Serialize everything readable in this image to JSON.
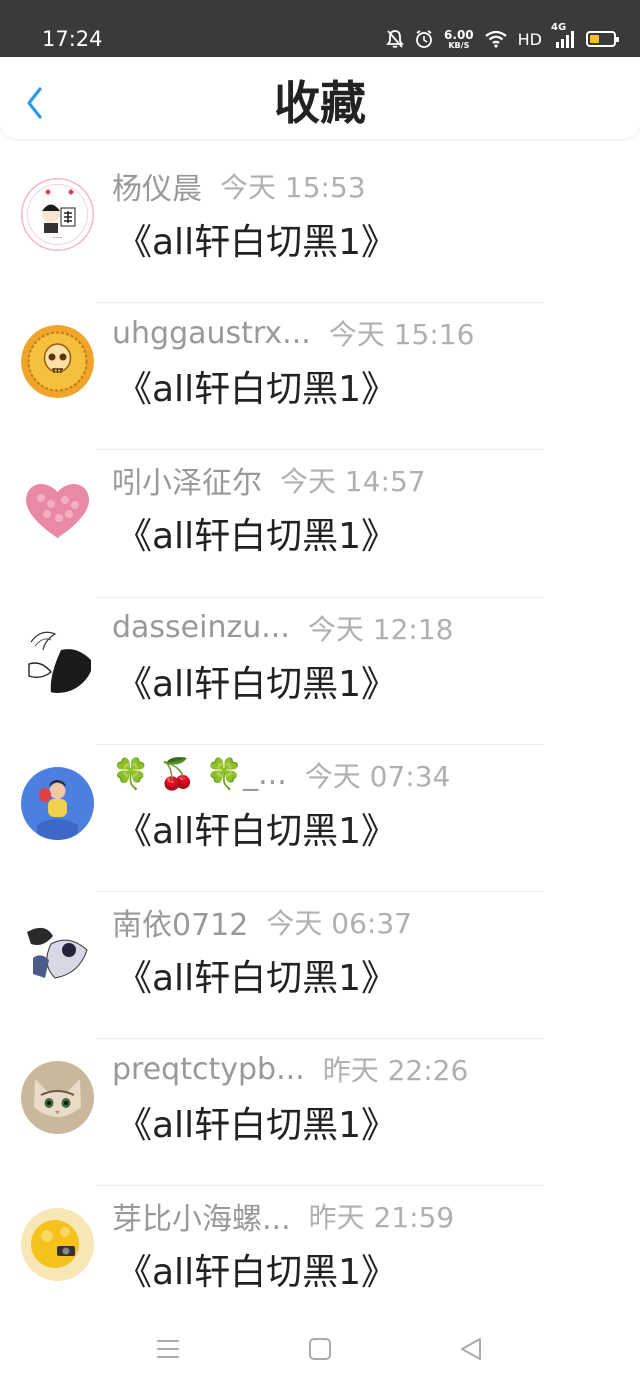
{
  "status_bar": {
    "time": "17:24",
    "speed_value": "6.00",
    "speed_unit": "KB/S",
    "hd_label": "HD",
    "network_label": "4G",
    "icons": [
      "mute-bell-icon",
      "alarm-icon",
      "wifi-icon",
      "signal-icon",
      "battery-icon"
    ],
    "battery_color": "#f2c513"
  },
  "header": {
    "back_icon": "chevron-left-icon",
    "title": "收藏",
    "accent": "#2b9ae8"
  },
  "favorites": [
    {
      "name": "杨仪晨",
      "time": "今天 15:53",
      "work": "《all轩白切黑1》",
      "avatar_icon": "avatar-chibi-frame"
    },
    {
      "name": "uhggaustrx...",
      "time": "今天 15:16",
      "work": "《all轩白切黑1》",
      "avatar_icon": "avatar-golden-skull"
    },
    {
      "name": "吲小泽征尔",
      "time": "今天 14:57",
      "work": "《all轩白切黑1》",
      "avatar_icon": "avatar-pink-heart"
    },
    {
      "name": "dasseinzu...",
      "time": "今天 12:18",
      "work": "《all轩白切黑1》",
      "avatar_icon": "avatar-ink-sketch"
    },
    {
      "name": "🍀 🍒 🍀_...",
      "time": "今天 07:34",
      "work": "《all轩白切黑1》",
      "avatar_icon": "avatar-person-blue"
    },
    {
      "name": "南依0712",
      "time": "今天 06:37",
      "work": "《all轩白切黑1》",
      "avatar_icon": "avatar-anime-pair"
    },
    {
      "name": "preqtctypb...",
      "time": "昨天 22:26",
      "work": "《all轩白切黑1》",
      "avatar_icon": "avatar-cat"
    },
    {
      "name": "芽比小海螺...",
      "time": "昨天 21:59",
      "work": "《all轩白切黑1》",
      "avatar_icon": "avatar-yellow-plush"
    }
  ],
  "system_nav": {
    "icons": [
      "menu-icon",
      "home-square-icon",
      "back-triangle-icon"
    ]
  }
}
